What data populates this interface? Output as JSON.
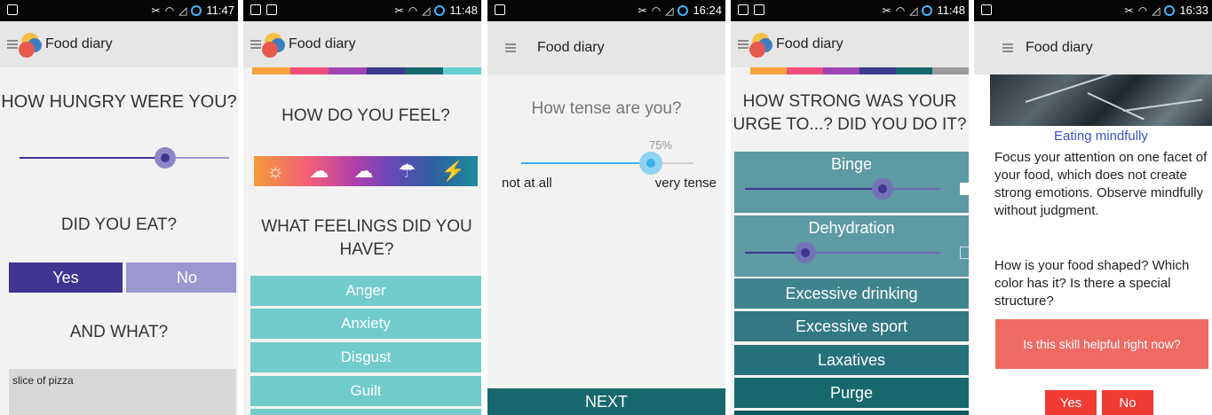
{
  "status_times": [
    "11:47",
    "11:48",
    "16:24",
    "11:48",
    "16:33"
  ],
  "app_title": "Food diary",
  "colors": {
    "accent": "#3f3591",
    "accent_light": "#9b97cf",
    "teal": "#72cbcb",
    "dark_teal": "#17686d",
    "red": "#f06a64",
    "link_blue": "#3a52c4",
    "progress_colors": [
      "#f6a33a",
      "#ee4e7b",
      "#9e45b3",
      "#3a3a8e",
      "#17686d",
      "#67cdd3"
    ]
  },
  "screen1": {
    "q1": "HOW HUNGRY WERE YOU?",
    "hunger_level": 0.7,
    "q2": "DID YOU EAT?",
    "yes": "Yes",
    "no": "No",
    "q3": "AND WHAT?",
    "food_text": "slice of pizza"
  },
  "screen2": {
    "q1": "HOW DO YOU FEEL?",
    "weather_icons": [
      "sun-icon",
      "cloud-sun-icon",
      "cloud-icon",
      "rain-icon",
      "storm-icon"
    ],
    "q2": "WHAT FEELINGS DID YOU HAVE?",
    "feelings": [
      "Anger",
      "Anxiety",
      "Disgust",
      "Guilt"
    ]
  },
  "screen3": {
    "question": "How tense are you?",
    "percent": "75%",
    "value": 0.75,
    "min_label": "not at all",
    "max_label": "very tense",
    "next": "NEXT"
  },
  "screen4": {
    "question": "HOW STRONG WAS YOUR URGE TO...? DID YOU DO IT?",
    "sliders": [
      {
        "label": "Binge",
        "value": 0.72,
        "checked": true
      },
      {
        "label": "Dehydration",
        "value": 0.28,
        "checked": false
      }
    ],
    "items": [
      "Excessive drinking",
      "Excessive sport",
      "Laxatives",
      "Purge"
    ]
  },
  "screen5": {
    "skill_title": "Eating mindfully",
    "paragraph1": "Focus your attention on one facet of your food, which does not create strong emotions. Observe mindfully without judgment.",
    "paragraph2": "How is your food shaped? Which color has it? Is there a special structure?",
    "helpful_question": "Is this skill helpful right now?",
    "yes": "Yes",
    "no": "No"
  }
}
